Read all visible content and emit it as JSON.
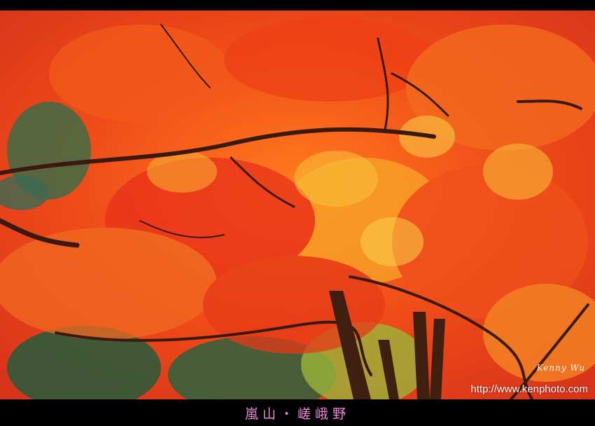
{
  "photo": {
    "subject": "maple-trees-autumn",
    "colors": {
      "leaf_red": "#e8301a",
      "leaf_orange": "#f56a1c",
      "leaf_yellow": "#f9c23a",
      "foliage_green": "#3f6b45",
      "branch": "#3a1a10"
    }
  },
  "caption": {
    "text": "嵐山・嵯峨野"
  },
  "signature": {
    "text": "Kenny Wu"
  },
  "watermark": {
    "url": "http://www.kenphoto.com"
  }
}
